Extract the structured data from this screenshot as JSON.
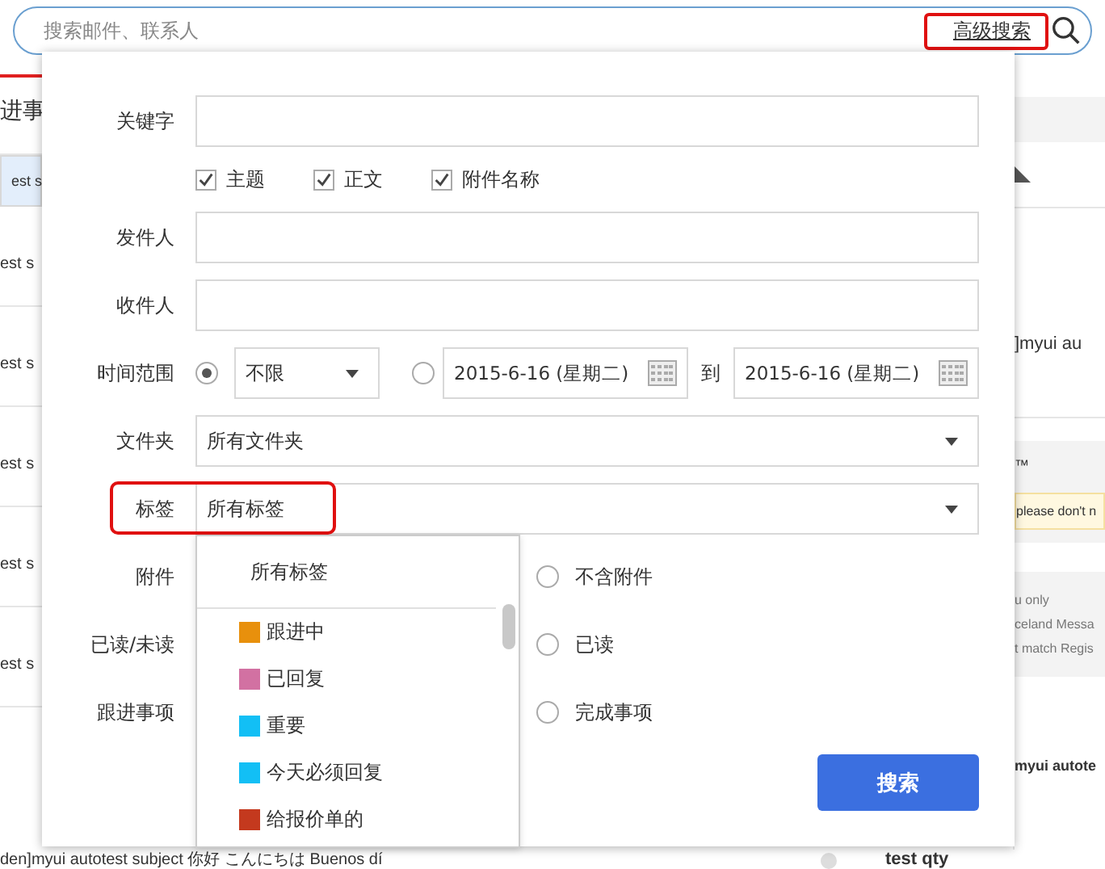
{
  "search": {
    "placeholder": "搜索邮件、联系人",
    "advanced_link": "高级搜索",
    "advanced_highlighted": true
  },
  "background": {
    "list_header": "进事",
    "list_rows": [
      {
        "text": "est s",
        "selected": true
      },
      {
        "text": "est s",
        "selected": false
      },
      {
        "text": "est s",
        "selected": false
      },
      {
        "text": "est s",
        "selected": false
      },
      {
        "text": "est s",
        "selected": false
      },
      {
        "text": "est s",
        "selected": false
      }
    ],
    "bottom_subject": "den]myui autotest subject 你好 こんにちは Buenos dí",
    "bottom_sender": "test qty",
    "reader_title": "]myui au",
    "reader_mark": "™",
    "reader_notice": "please don't n",
    "reader_info": [
      "u only",
      "celand Messa",
      "t match Regis"
    ],
    "reader_next": "myui autote"
  },
  "form": {
    "keyword": {
      "label": "关键字"
    },
    "scopes": [
      {
        "label": "主题",
        "checked": true
      },
      {
        "label": "正文",
        "checked": true
      },
      {
        "label": "附件名称",
        "checked": true
      }
    ],
    "sender": {
      "label": "发件人"
    },
    "recipient": {
      "label": "收件人"
    },
    "time_range": {
      "label": "时间范围",
      "options": [
        {
          "kind": "select",
          "value": "不限",
          "selected": true
        },
        {
          "kind": "dates",
          "from": "2015-6-16 (星期二)",
          "between": "到",
          "to": "2015-6-16 (星期二)",
          "selected": false
        }
      ]
    },
    "folder": {
      "label": "文件夹",
      "value": "所有文件夹"
    },
    "tags": {
      "label": "标签",
      "value": "所有标签",
      "highlighted": true,
      "expanded": true,
      "menu": {
        "header": "所有标签",
        "items": [
          {
            "label": "跟进中",
            "color": "#e8900c"
          },
          {
            "label": "已回复",
            "color": "#d271a2"
          },
          {
            "label": "重要",
            "color": "#12bff5"
          },
          {
            "label": "今天必须回复",
            "color": "#12bff5"
          },
          {
            "label": "给报价单的",
            "color": "#c4391e"
          }
        ]
      }
    },
    "radio_rows": [
      {
        "label": "附件",
        "option": "不含附件",
        "selected": false
      },
      {
        "label": "已读/未读",
        "option": "已读",
        "selected": false
      },
      {
        "label": "跟进事项",
        "option": "完成事项",
        "selected": false
      }
    ],
    "search_button": "搜索"
  }
}
